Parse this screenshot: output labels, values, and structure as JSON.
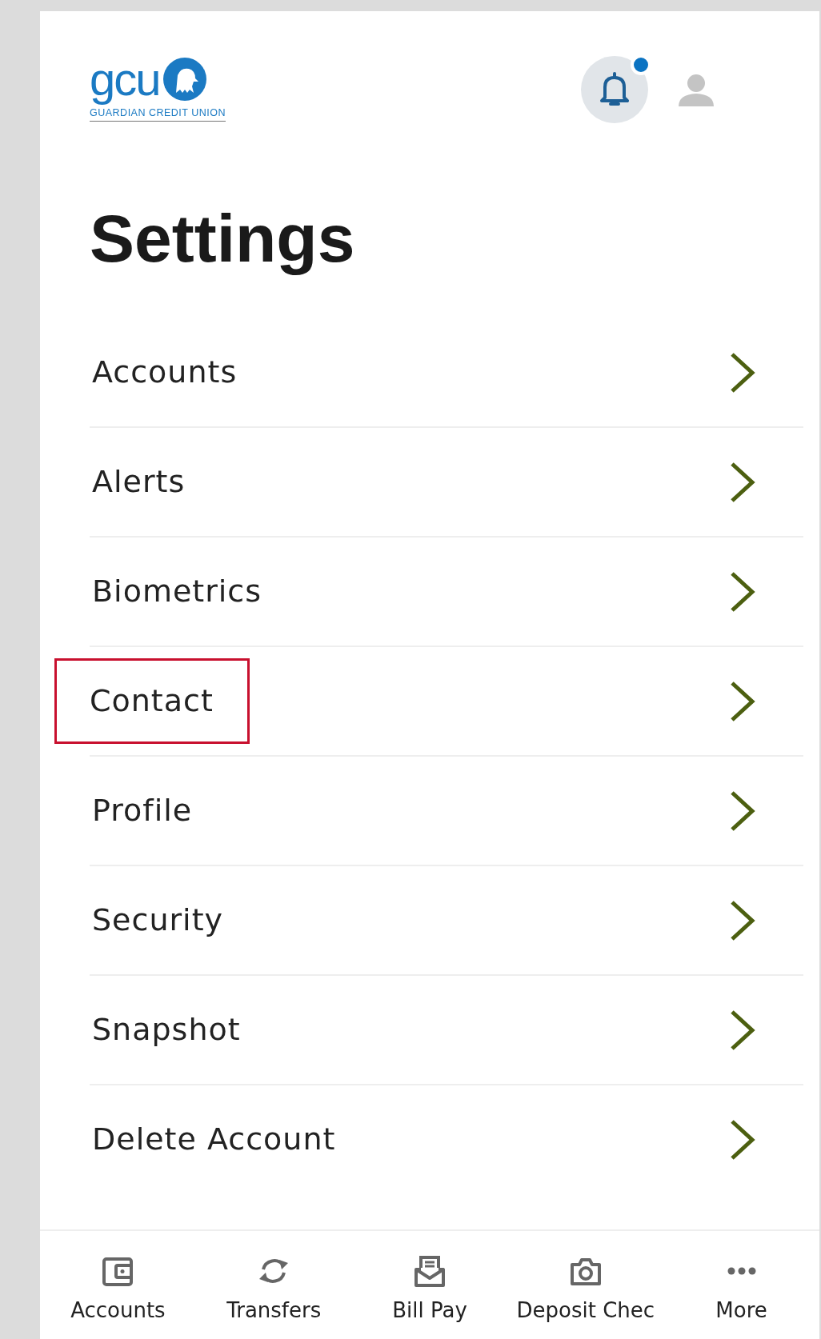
{
  "header": {
    "logo_text": "gcu",
    "logo_subtitle": "GUARDIAN CREDIT UNION",
    "notification_unread": true
  },
  "title": "Settings",
  "settings_items": [
    {
      "label": "Accounts",
      "highlighted": false
    },
    {
      "label": "Alerts",
      "highlighted": false
    },
    {
      "label": "Biometrics",
      "highlighted": false
    },
    {
      "label": "Contact",
      "highlighted": true
    },
    {
      "label": "Profile",
      "highlighted": false
    },
    {
      "label": "Security",
      "highlighted": false
    },
    {
      "label": "Snapshot",
      "highlighted": false
    },
    {
      "label": "Delete Account",
      "highlighted": false
    }
  ],
  "bottom_nav": [
    {
      "label": "Accounts",
      "kind": "wallet"
    },
    {
      "label": "Transfers",
      "kind": "sync"
    },
    {
      "label": "Bill Pay",
      "kind": "bill"
    },
    {
      "label": "Deposit Chec",
      "kind": "camera"
    },
    {
      "label": "More",
      "kind": "dots"
    }
  ]
}
